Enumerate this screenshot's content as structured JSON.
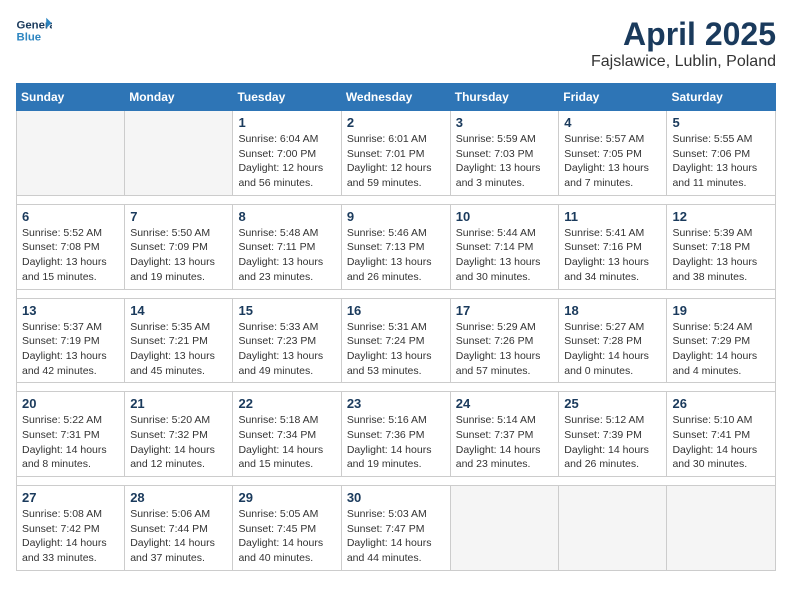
{
  "header": {
    "logo_line1": "General",
    "logo_line2": "Blue",
    "month": "April 2025",
    "location": "Fajslawice, Lublin, Poland"
  },
  "weekdays": [
    "Sunday",
    "Monday",
    "Tuesday",
    "Wednesday",
    "Thursday",
    "Friday",
    "Saturday"
  ],
  "weeks": [
    [
      {
        "day": "",
        "info": ""
      },
      {
        "day": "",
        "info": ""
      },
      {
        "day": "1",
        "info": "Sunrise: 6:04 AM\nSunset: 7:00 PM\nDaylight: 12 hours\nand 56 minutes."
      },
      {
        "day": "2",
        "info": "Sunrise: 6:01 AM\nSunset: 7:01 PM\nDaylight: 12 hours\nand 59 minutes."
      },
      {
        "day": "3",
        "info": "Sunrise: 5:59 AM\nSunset: 7:03 PM\nDaylight: 13 hours\nand 3 minutes."
      },
      {
        "day": "4",
        "info": "Sunrise: 5:57 AM\nSunset: 7:05 PM\nDaylight: 13 hours\nand 7 minutes."
      },
      {
        "day": "5",
        "info": "Sunrise: 5:55 AM\nSunset: 7:06 PM\nDaylight: 13 hours\nand 11 minutes."
      }
    ],
    [
      {
        "day": "6",
        "info": "Sunrise: 5:52 AM\nSunset: 7:08 PM\nDaylight: 13 hours\nand 15 minutes."
      },
      {
        "day": "7",
        "info": "Sunrise: 5:50 AM\nSunset: 7:09 PM\nDaylight: 13 hours\nand 19 minutes."
      },
      {
        "day": "8",
        "info": "Sunrise: 5:48 AM\nSunset: 7:11 PM\nDaylight: 13 hours\nand 23 minutes."
      },
      {
        "day": "9",
        "info": "Sunrise: 5:46 AM\nSunset: 7:13 PM\nDaylight: 13 hours\nand 26 minutes."
      },
      {
        "day": "10",
        "info": "Sunrise: 5:44 AM\nSunset: 7:14 PM\nDaylight: 13 hours\nand 30 minutes."
      },
      {
        "day": "11",
        "info": "Sunrise: 5:41 AM\nSunset: 7:16 PM\nDaylight: 13 hours\nand 34 minutes."
      },
      {
        "day": "12",
        "info": "Sunrise: 5:39 AM\nSunset: 7:18 PM\nDaylight: 13 hours\nand 38 minutes."
      }
    ],
    [
      {
        "day": "13",
        "info": "Sunrise: 5:37 AM\nSunset: 7:19 PM\nDaylight: 13 hours\nand 42 minutes."
      },
      {
        "day": "14",
        "info": "Sunrise: 5:35 AM\nSunset: 7:21 PM\nDaylight: 13 hours\nand 45 minutes."
      },
      {
        "day": "15",
        "info": "Sunrise: 5:33 AM\nSunset: 7:23 PM\nDaylight: 13 hours\nand 49 minutes."
      },
      {
        "day": "16",
        "info": "Sunrise: 5:31 AM\nSunset: 7:24 PM\nDaylight: 13 hours\nand 53 minutes."
      },
      {
        "day": "17",
        "info": "Sunrise: 5:29 AM\nSunset: 7:26 PM\nDaylight: 13 hours\nand 57 minutes."
      },
      {
        "day": "18",
        "info": "Sunrise: 5:27 AM\nSunset: 7:28 PM\nDaylight: 14 hours\nand 0 minutes."
      },
      {
        "day": "19",
        "info": "Sunrise: 5:24 AM\nSunset: 7:29 PM\nDaylight: 14 hours\nand 4 minutes."
      }
    ],
    [
      {
        "day": "20",
        "info": "Sunrise: 5:22 AM\nSunset: 7:31 PM\nDaylight: 14 hours\nand 8 minutes."
      },
      {
        "day": "21",
        "info": "Sunrise: 5:20 AM\nSunset: 7:32 PM\nDaylight: 14 hours\nand 12 minutes."
      },
      {
        "day": "22",
        "info": "Sunrise: 5:18 AM\nSunset: 7:34 PM\nDaylight: 14 hours\nand 15 minutes."
      },
      {
        "day": "23",
        "info": "Sunrise: 5:16 AM\nSunset: 7:36 PM\nDaylight: 14 hours\nand 19 minutes."
      },
      {
        "day": "24",
        "info": "Sunrise: 5:14 AM\nSunset: 7:37 PM\nDaylight: 14 hours\nand 23 minutes."
      },
      {
        "day": "25",
        "info": "Sunrise: 5:12 AM\nSunset: 7:39 PM\nDaylight: 14 hours\nand 26 minutes."
      },
      {
        "day": "26",
        "info": "Sunrise: 5:10 AM\nSunset: 7:41 PM\nDaylight: 14 hours\nand 30 minutes."
      }
    ],
    [
      {
        "day": "27",
        "info": "Sunrise: 5:08 AM\nSunset: 7:42 PM\nDaylight: 14 hours\nand 33 minutes."
      },
      {
        "day": "28",
        "info": "Sunrise: 5:06 AM\nSunset: 7:44 PM\nDaylight: 14 hours\nand 37 minutes."
      },
      {
        "day": "29",
        "info": "Sunrise: 5:05 AM\nSunset: 7:45 PM\nDaylight: 14 hours\nand 40 minutes."
      },
      {
        "day": "30",
        "info": "Sunrise: 5:03 AM\nSunset: 7:47 PM\nDaylight: 14 hours\nand 44 minutes."
      },
      {
        "day": "",
        "info": ""
      },
      {
        "day": "",
        "info": ""
      },
      {
        "day": "",
        "info": ""
      }
    ]
  ]
}
